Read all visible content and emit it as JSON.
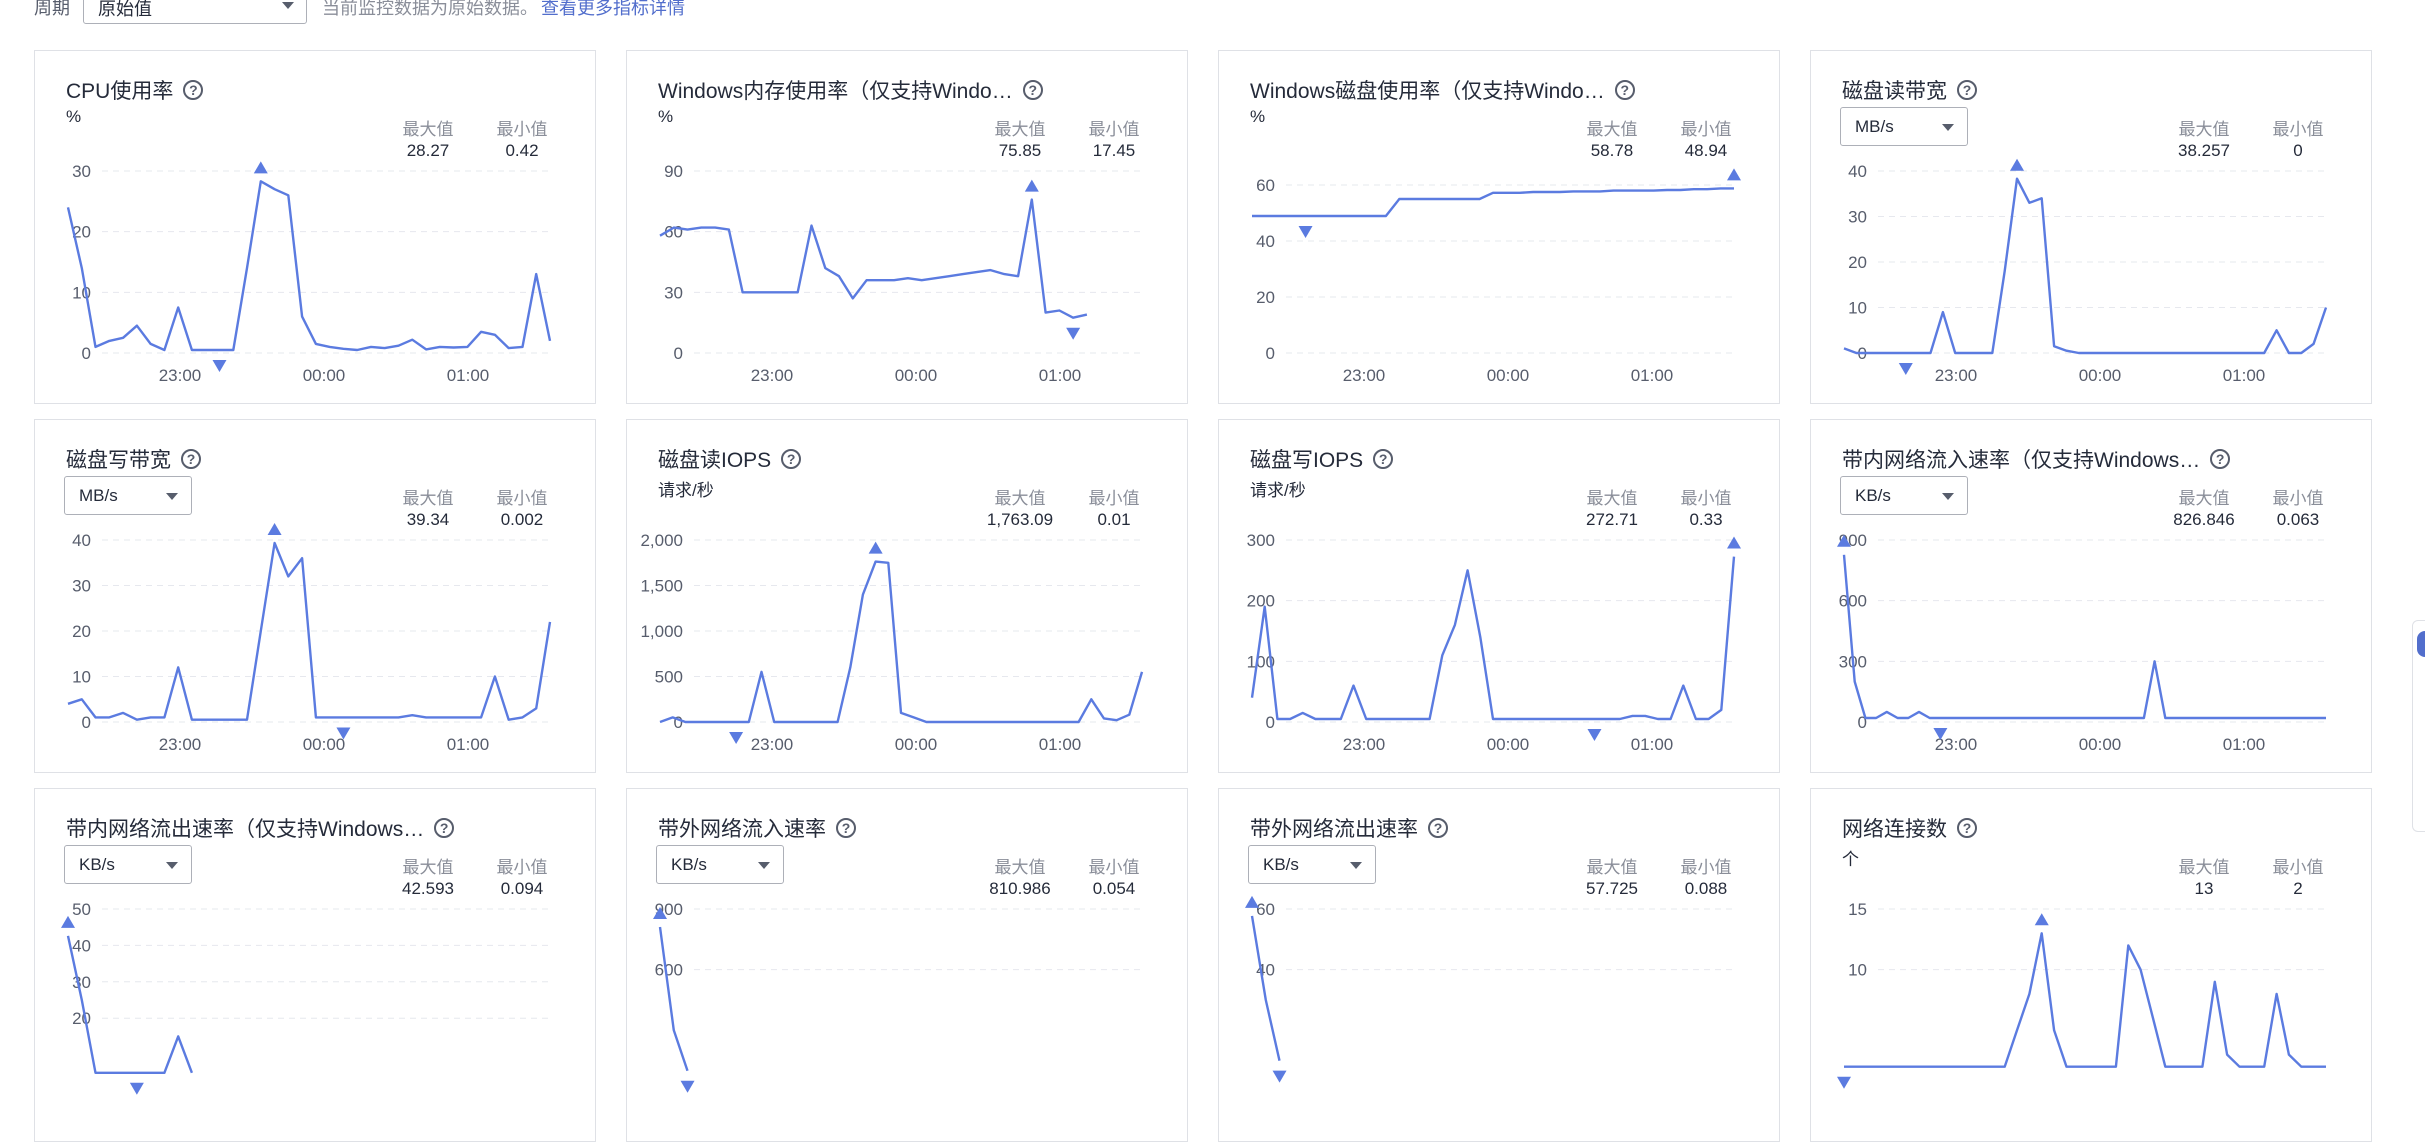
{
  "toolbar": {
    "period_label": "周期",
    "period_value": "原始值",
    "hint": "当前监控数据为原始数据。",
    "link": "查看更多指标详情"
  },
  "stat_labels": {
    "max": "最大值",
    "min": "最小值"
  },
  "cards": [
    {
      "title": "CPU使用率",
      "unit": "%",
      "unit_select": false,
      "max": "28.27",
      "min": "0.42",
      "yticks": [
        "30",
        "20",
        "10",
        "0"
      ],
      "xticks": [
        "23:00",
        "00:00",
        "01:00"
      ],
      "chart_data": {
        "type": "line",
        "ylim": [
          0,
          30
        ],
        "values": [
          24,
          14,
          1,
          2,
          2.5,
          4.5,
          1.5,
          0.5,
          7.5,
          0.5,
          0.5,
          0.5,
          0.5,
          14,
          28.3,
          27,
          26,
          6,
          1.5,
          1,
          0.7,
          0.5,
          1,
          0.8,
          1.2,
          2.2,
          0.6,
          1,
          0.9,
          1,
          3.5,
          3,
          0.8,
          1,
          13,
          2
        ],
        "max_index": 14,
        "min_index": 11
      }
    },
    {
      "title": "Windows内存使用率（仅支持Windo…",
      "unit": "%",
      "unit_select": false,
      "max": "75.85",
      "min": "17.45",
      "yticks": [
        "90",
        "60",
        "30",
        "0"
      ],
      "xticks": [
        "23:00",
        "00:00",
        "01:00"
      ],
      "chart_data": {
        "type": "line",
        "ylim": [
          0,
          90
        ],
        "values": [
          58,
          62,
          61,
          62,
          62,
          61,
          30,
          30,
          30,
          30,
          30,
          63,
          42,
          38,
          27,
          36,
          36,
          36,
          37,
          36,
          37,
          38,
          39,
          40,
          41,
          39,
          38,
          75.85,
          20,
          21,
          17.45,
          19
        ],
        "max_index": 27,
        "min_index": 30
      }
    },
    {
      "title": "Windows磁盘使用率（仅支持Windo…",
      "unit": "%",
      "unit_select": false,
      "max": "58.78",
      "min": "48.94",
      "yticks": [
        "60",
        "40",
        "20",
        "0"
      ],
      "xticks": [
        "23:00",
        "00:00",
        "01:00"
      ],
      "chart_data": {
        "type": "line",
        "ylim": [
          0,
          65
        ],
        "values": [
          48.94,
          48.94,
          48.94,
          48.94,
          48.94,
          48.94,
          48.94,
          48.94,
          48.94,
          48.94,
          48.94,
          55,
          55,
          55,
          55,
          55,
          55,
          55,
          57.2,
          57.2,
          57.2,
          57.5,
          57.5,
          57.5,
          57.7,
          57.7,
          57.7,
          58,
          58,
          58,
          58,
          58.2,
          58.2,
          58.5,
          58.5,
          58.78,
          58.78
        ],
        "max_index": 36,
        "min_index": 4
      }
    },
    {
      "title": "磁盘读带宽",
      "unit": "MB/s",
      "unit_select": true,
      "max": "38.257",
      "min": "0",
      "yticks": [
        "40",
        "30",
        "20",
        "10",
        "0"
      ],
      "xticks": [
        "23:00",
        "00:00",
        "01:00"
      ],
      "chart_data": {
        "type": "line",
        "ylim": [
          0,
          40
        ],
        "values": [
          1,
          0,
          0,
          0,
          0,
          0,
          0,
          0,
          9,
          0,
          0,
          0,
          0,
          18,
          38.3,
          33,
          34,
          1.5,
          0.5,
          0,
          0,
          0,
          0,
          0,
          0,
          0,
          0,
          0,
          0,
          0,
          0,
          0,
          0,
          0,
          0,
          5,
          0,
          0,
          2,
          10
        ],
        "max_index": 14,
        "min_index": 5
      }
    },
    {
      "title": "磁盘写带宽",
      "unit": "MB/s",
      "unit_select": true,
      "max": "39.34",
      "min": "0.002",
      "yticks": [
        "40",
        "30",
        "20",
        "10",
        "0"
      ],
      "xticks": [
        "23:00",
        "00:00",
        "01:00"
      ],
      "chart_data": {
        "type": "line",
        "ylim": [
          0,
          40
        ],
        "values": [
          4,
          5,
          1,
          1,
          2,
          0.5,
          1,
          1,
          12,
          0.5,
          0.5,
          0.5,
          0.5,
          0.5,
          20,
          39.34,
          32,
          36,
          1,
          1,
          1,
          1,
          1,
          1,
          1,
          1.5,
          1,
          1,
          1,
          1,
          1,
          10,
          0.5,
          1,
          3,
          22
        ],
        "max_index": 15,
        "min_index": 20
      }
    },
    {
      "title": "磁盘读IOPS",
      "unit": "请求/秒",
      "unit_select": false,
      "max": "1,763.09",
      "min": "0.01",
      "yticks": [
        "2,000",
        "1,500",
        "1,000",
        "500",
        "0"
      ],
      "xticks": [
        "23:00",
        "00:00",
        "01:00"
      ],
      "chart_data": {
        "type": "line",
        "ylim": [
          0,
          2000
        ],
        "values": [
          0,
          50,
          0,
          0,
          0,
          0,
          0,
          0,
          550,
          0,
          0,
          0,
          0,
          0,
          0,
          600,
          1400,
          1763,
          1750,
          100,
          50,
          0,
          0,
          0,
          0,
          0,
          0,
          0,
          0,
          0,
          0,
          0,
          0,
          0,
          250,
          40,
          20,
          80,
          550
        ],
        "max_index": 17,
        "min_index": 6
      }
    },
    {
      "title": "磁盘写IOPS",
      "unit": "请求/秒",
      "unit_select": false,
      "max": "272.71",
      "min": "0.33",
      "yticks": [
        "300",
        "200",
        "100",
        "0"
      ],
      "xticks": [
        "23:00",
        "00:00",
        "01:00"
      ],
      "chart_data": {
        "type": "line",
        "ylim": [
          0,
          300
        ],
        "values": [
          40,
          190,
          5,
          5,
          15,
          5,
          5,
          5,
          60,
          5,
          5,
          5,
          5,
          5,
          5,
          110,
          160,
          250,
          140,
          5,
          5,
          5,
          5,
          5,
          5,
          5,
          5,
          5,
          5,
          5,
          10,
          10,
          5,
          5,
          60,
          5,
          5,
          20,
          272.71
        ],
        "max_index": 38,
        "min_index": 27
      }
    },
    {
      "title": "带内网络流入速率（仅支持Windows…",
      "unit": "KB/s",
      "unit_select": true,
      "max": "826.846",
      "min": "0.063",
      "yticks": [
        "900",
        "600",
        "300",
        "0"
      ],
      "xticks": [
        "23:00",
        "00:00",
        "01:00"
      ],
      "chart_data": {
        "type": "line",
        "ylim": [
          0,
          900
        ],
        "values": [
          826.8,
          200,
          20,
          20,
          50,
          20,
          20,
          50,
          20,
          20,
          20,
          20,
          20,
          20,
          20,
          20,
          20,
          20,
          20,
          20,
          20,
          20,
          20,
          20,
          20,
          20,
          20,
          20,
          20,
          300,
          20,
          20,
          20,
          20,
          20,
          20,
          20,
          20,
          20,
          20,
          20,
          20,
          20,
          20,
          20,
          20
        ],
        "max_index": 0,
        "min_index": 9
      }
    },
    {
      "title": "带内网络流出速率（仅支持Windows…",
      "unit": "KB/s",
      "unit_select": true,
      "max": "42.593",
      "min": "0.094",
      "yticks": [
        "50",
        "40",
        "30",
        "20"
      ],
      "xticks": [],
      "chart_data": {
        "type": "line",
        "ylim": [
          0,
          50
        ],
        "values": [
          42.6,
          25,
          5,
          5,
          5,
          5,
          5,
          5,
          15,
          5
        ],
        "max_index": 0,
        "min_index": 5
      }
    },
    {
      "title": "带外网络流入速率",
      "unit": "KB/s",
      "unit_select": true,
      "max": "810.986",
      "min": "0.054",
      "yticks": [
        "900",
        "600"
      ],
      "xticks": [],
      "chart_data": {
        "type": "line",
        "ylim": [
          0,
          900
        ],
        "values": [
          810.986,
          300,
          100
        ],
        "max_index": 0,
        "min_index": 2
      }
    },
    {
      "title": "带外网络流出速率",
      "unit": "KB/s",
      "unit_select": true,
      "max": "57.725",
      "min": "0.088",
      "yticks": [
        "60",
        "40"
      ],
      "xticks": [],
      "chart_data": {
        "type": "line",
        "ylim": [
          0,
          60
        ],
        "values": [
          57.725,
          30,
          10
        ],
        "max_index": 0,
        "min_index": 2
      }
    },
    {
      "title": "网络连接数",
      "unit": "个",
      "unit_select": false,
      "max": "13",
      "min": "2",
      "yticks": [
        "15",
        "10"
      ],
      "xticks": [],
      "chart_data": {
        "type": "line",
        "ylim": [
          0,
          15
        ],
        "values": [
          2,
          2,
          2,
          2,
          2,
          2,
          2,
          2,
          2,
          2,
          2,
          2,
          2,
          2,
          5,
          8,
          13,
          5,
          2,
          2,
          2,
          2,
          2,
          12,
          10,
          6,
          2,
          2,
          2,
          2,
          9,
          3,
          2,
          2,
          2,
          8,
          3,
          2,
          2,
          2
        ],
        "max_index": 16,
        "min_index": 0
      }
    }
  ]
}
